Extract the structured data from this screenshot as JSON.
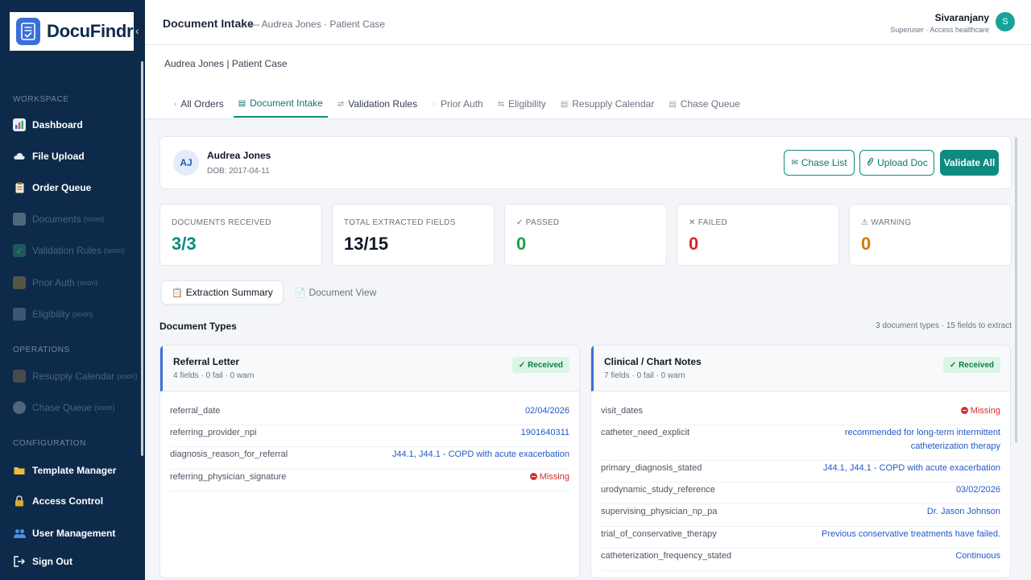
{
  "app": {
    "name": "DocuFindr"
  },
  "sidebar": {
    "sections": {
      "workspace": "WORKSPACE",
      "operations": "OPERATIONS",
      "configuration": "CONFIGURATION"
    },
    "items": [
      {
        "label": "Dashboard",
        "icon": "chart-icon",
        "soon": ""
      },
      {
        "label": "File Upload",
        "icon": "cloud-icon",
        "soon": ""
      },
      {
        "label": "Order Queue",
        "icon": "clipboard-icon",
        "soon": ""
      },
      {
        "label": "Documents",
        "icon": "document-icon",
        "soon": "(soon)"
      },
      {
        "label": "Validation Rules",
        "icon": "check-icon",
        "soon": "(soon)"
      },
      {
        "label": "Prior Auth",
        "icon": "lock-icon",
        "soon": "(soon)"
      },
      {
        "label": "Eligibility",
        "icon": "building-icon",
        "soon": "(soon)"
      },
      {
        "label": "Resupply Calendar",
        "icon": "box-icon",
        "soon": "(soon)"
      },
      {
        "label": "Chase Queue",
        "icon": "chat-icon",
        "soon": "(soon)"
      },
      {
        "label": "Template Manager",
        "icon": "folder-icon",
        "soon": ""
      },
      {
        "label": "Access Control",
        "icon": "lock-icon",
        "soon": ""
      },
      {
        "label": "User Management",
        "icon": "users-icon",
        "soon": ""
      }
    ],
    "sign_out": "Sign Out"
  },
  "header": {
    "title": "Document Intake",
    "subtitle": "— Audrea Jones · Patient Case",
    "user_name": "Sivaranjany",
    "user_role": "Superuser · Access healthcare",
    "user_initial": "S"
  },
  "case": {
    "title": "Audrea Jones | Patient Case",
    "tabs": [
      {
        "label": "All Orders",
        "icon": "‹"
      },
      {
        "label": "Document Intake",
        "icon": "▤"
      },
      {
        "label": "Validation Rules",
        "icon": "⇄"
      },
      {
        "label": "Prior Auth",
        "icon": "◌"
      },
      {
        "label": "Eligibility",
        "icon": "⇆"
      },
      {
        "label": "Resupply Calendar",
        "icon": "▤"
      },
      {
        "label": "Chase Queue",
        "icon": "▤"
      }
    ]
  },
  "patient": {
    "initials": "AJ",
    "name": "Audrea Jones",
    "dob": "DOB: 2017-04-11"
  },
  "actions": {
    "chase_list": "Chase List",
    "upload_doc": "Upload Doc",
    "validate_all": "Validate All"
  },
  "stats": [
    {
      "label": "DOCUMENTS RECEIVED",
      "value": "3/3",
      "color": "#0f8a7e",
      "prefix": ""
    },
    {
      "label": "TOTAL EXTRACTED FIELDS",
      "value": "13/15",
      "color": "#111827",
      "prefix": ""
    },
    {
      "label": "PASSED",
      "value": "0",
      "color": "#16a34a",
      "prefix": "✓ "
    },
    {
      "label": "FAILED",
      "value": "0",
      "color": "#dc2626",
      "prefix": "✕ "
    },
    {
      "label": "WARNING",
      "value": "0",
      "color": "#d97706",
      "prefix": "⚠ "
    }
  ],
  "subtabs": [
    {
      "label": "Extraction Summary"
    },
    {
      "label": "Document View"
    }
  ],
  "doc_types": {
    "title": "Document Types",
    "meta": "3 document types · 15 fields to extract",
    "cards": [
      {
        "name": "Referral Letter",
        "meta": "4 fields · 0 fail · 0 warn",
        "status": "✓ Received",
        "fields": [
          {
            "name": "referral_date",
            "value": "02/04/2026"
          },
          {
            "name": "referring_provider_npi",
            "value": "1901640311"
          },
          {
            "name": "diagnosis_reason_for_referral",
            "value": "J44.1, J44.1 - COPD with acute exacerbation"
          },
          {
            "name": "referring_physician_signature",
            "value": "Missing"
          }
        ]
      },
      {
        "name": "Clinical / Chart Notes",
        "meta": "7 fields · 0 fail · 0 warn",
        "status": "✓ Received",
        "fields": [
          {
            "name": "visit_dates",
            "value": "Missing"
          },
          {
            "name": "catheter_need_explicit",
            "value": "recommended for long-term intermittent catheterization therapy"
          },
          {
            "name": "primary_diagnosis_stated",
            "value": "J44.1, J44.1 - COPD with acute exacerbation"
          },
          {
            "name": "urodynamic_study_reference",
            "value": "03/02/2026"
          },
          {
            "name": "supervising_physician_np_pa",
            "value": "Dr. Jason Johnson"
          },
          {
            "name": "trial_of_conservative_therapy",
            "value": "Previous conservative treatments have failed."
          },
          {
            "name": "catheterization_frequency_stated",
            "value": "Continuous"
          }
        ]
      }
    ]
  }
}
